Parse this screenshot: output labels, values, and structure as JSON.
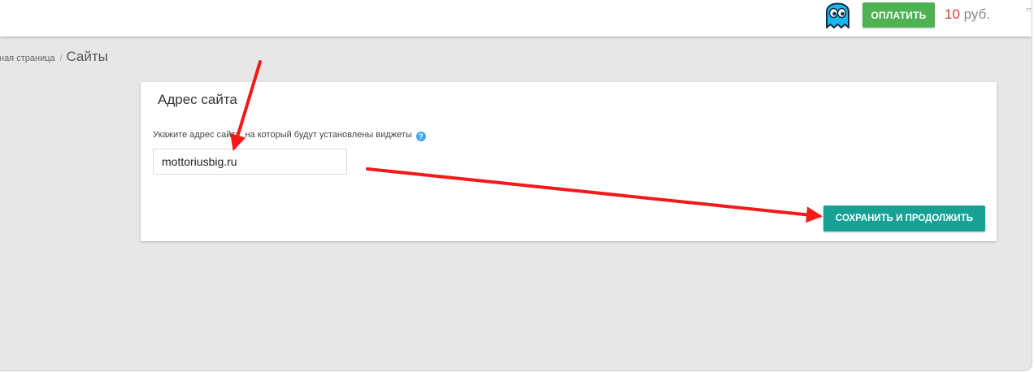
{
  "topbar": {
    "mascot_icon": "ghost-mascot-icon",
    "pay_label": "ОПЛАТИТЬ",
    "balance_amount": "10",
    "balance_currency": "руб.",
    "cut_text": "ст"
  },
  "breadcrumb": {
    "home": "зная страница",
    "separator": "/",
    "current": "Сайты"
  },
  "card": {
    "title": "Адрес сайта",
    "label": "Укажите адрес сайта, на который будут установлены виджеты",
    "help_icon": "question-icon",
    "input_value": "mottoriusbig.ru",
    "save_label": "СОХРАНИТЬ И ПРОДОЛЖИТЬ"
  },
  "colors": {
    "background": "#e6e7e6",
    "pay_button": "#4fb252",
    "save_button": "#17a194",
    "price": "#e53935",
    "annotation_arrow": "#f41a1a"
  }
}
